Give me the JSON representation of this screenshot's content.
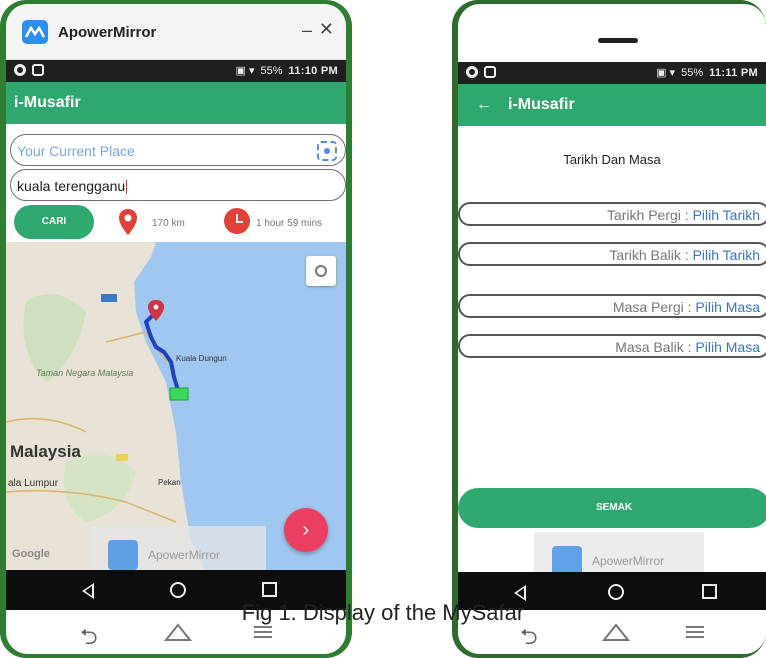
{
  "left_phone": {
    "window_title": "ApowerMirror",
    "window_minimize": "–",
    "window_close": "✕",
    "status_time": "11:10 PM",
    "status_battery": "55%",
    "app_title": "i-Musafir",
    "current_place_placeholder": "Your Current Place",
    "destination_value": "kuala terengganu",
    "search_button": "CARI",
    "distance": "170 km",
    "duration": "1 hour 59 mins",
    "map": {
      "country_label": "Malaysia",
      "city_label": "ala Lumpur",
      "park_label": "Taman Negara Malaysia",
      "town_label_1": "Kuala Dungun",
      "town_label_2": "Pekan",
      "attribution": "Google"
    },
    "fab_label": "›",
    "watermark_text": "ApowerMirror"
  },
  "right_phone": {
    "status_time": "11:11 PM",
    "status_battery": "55%",
    "back_arrow": "←",
    "app_title": "i-Musafir",
    "section_title": "Tarikh Dan Masa",
    "fields": [
      {
        "label": "Tarikh Pergi :",
        "value": "Pilih Tarikh"
      },
      {
        "label": "Tarikh Balik :",
        "value": "Pilih Tarikh"
      },
      {
        "label": "Masa Pergi :",
        "value": "Pilih Masa"
      },
      {
        "label": "Masa Balik :",
        "value": "Pilih Masa"
      }
    ],
    "submit_button": "SEMAK",
    "watermark_text": "ApowerMirror"
  },
  "caption": "Fig 1. Display of the MySafar",
  "colors": {
    "brand_green": "#2fa86f",
    "pin_red": "#e3403a",
    "fab_pink": "#ea3f61",
    "link_blue": "#3b74c6",
    "route_blue": "#2040c0"
  }
}
